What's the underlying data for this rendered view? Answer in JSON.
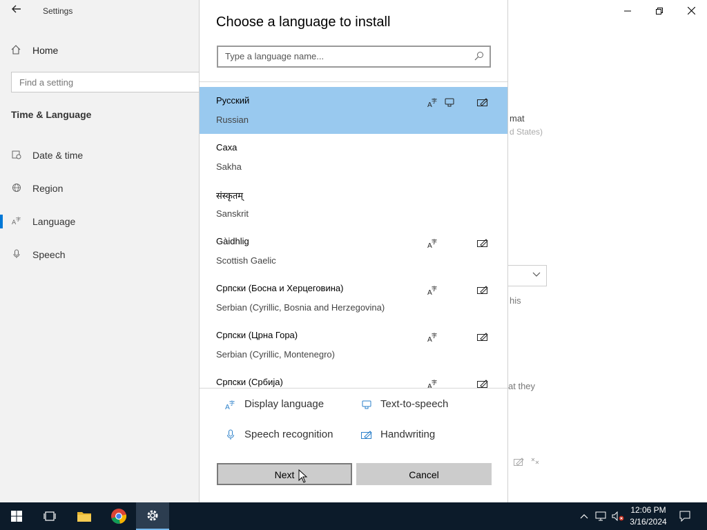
{
  "window": {
    "app_title": "Settings",
    "back_icon": "back-arrow-icon",
    "controls": [
      "minimize",
      "restore",
      "close"
    ]
  },
  "sidebar": {
    "home_label": "Home",
    "search_placeholder": "Find a setting",
    "section_title": "Time & Language",
    "items": [
      {
        "label": "Date & time",
        "icon": "calendar-clock-icon"
      },
      {
        "label": "Region",
        "icon": "globe-icon"
      },
      {
        "label": "Language",
        "icon": "language-icon",
        "selected": true
      },
      {
        "label": "Speech",
        "icon": "microphone-icon"
      }
    ]
  },
  "background_fragments": {
    "format_text": "mat",
    "format_sub": "d States)",
    "this_text": "his",
    "they_text": "at they"
  },
  "dialog": {
    "title": "Choose a language to install",
    "search_placeholder": "Type a language name...",
    "languages": [
      {
        "native": "Русский",
        "english": "Russian",
        "display_language": true,
        "text_to_speech": true,
        "handwriting": true,
        "selected": true
      },
      {
        "native": "Саха",
        "english": "Sakha",
        "display_language": false,
        "text_to_speech": false,
        "handwriting": false
      },
      {
        "native": "संस्कृतम्",
        "english": "Sanskrit",
        "display_language": false,
        "text_to_speech": false,
        "handwriting": false
      },
      {
        "native": "Gàidhlig",
        "english": "Scottish Gaelic",
        "display_language": true,
        "text_to_speech": false,
        "handwriting": true
      },
      {
        "native": "Српски (Босна и Херцеговина)",
        "english": "Serbian (Cyrillic, Bosnia and Herzegovina)",
        "display_language": true,
        "text_to_speech": false,
        "handwriting": true
      },
      {
        "native": "Српски (Црна Гора)",
        "english": "Serbian (Cyrillic, Montenegro)",
        "display_language": true,
        "text_to_speech": false,
        "handwriting": true
      },
      {
        "native": "Српски (Србија)",
        "english": "",
        "display_language": true,
        "text_to_speech": false,
        "handwriting": true
      }
    ],
    "legend": {
      "display_language": "Display language",
      "text_to_speech": "Text-to-speech",
      "speech_recognition": "Speech recognition",
      "handwriting": "Handwriting"
    },
    "next_label": "Next",
    "cancel_label": "Cancel"
  },
  "taskbar": {
    "pinned": [
      "start-icon",
      "task-view-icon",
      "file-explorer-icon",
      "chrome-icon",
      "settings-icon"
    ],
    "active": "settings-icon",
    "time": "12:06 PM",
    "date": "3/16/2024"
  },
  "colors": {
    "accent": "#0078d7",
    "selected_row": "#99c9ef",
    "taskbar": "#0c1b2a",
    "button": "#cccccc"
  }
}
